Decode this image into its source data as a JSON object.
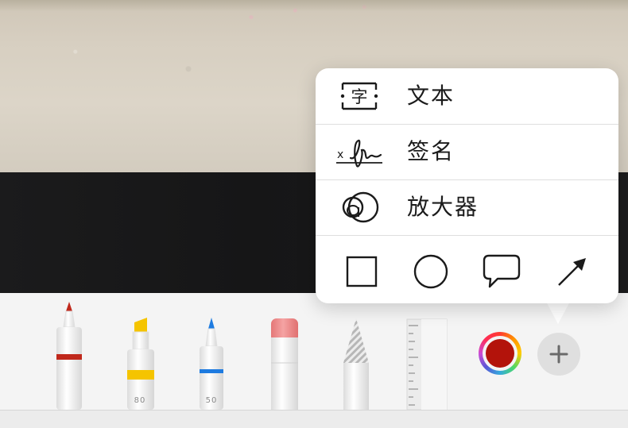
{
  "popover": {
    "items": [
      {
        "label": "文本",
        "icon": "text-box-icon",
        "glyph": "字"
      },
      {
        "label": "签名",
        "icon": "signature-icon",
        "glyph": "x"
      },
      {
        "label": "放大器",
        "icon": "magnifier-icon"
      }
    ],
    "shapes": [
      "square-icon",
      "circle-icon",
      "speech-bubble-icon",
      "arrow-icon"
    ]
  },
  "toolbar": {
    "tools": [
      {
        "name": "pen",
        "tip_color": "#c0281b",
        "band_color": "#c0281b"
      },
      {
        "name": "highlighter",
        "tip_color": "#f5c400",
        "band_color": "#f5c400",
        "label": "80"
      },
      {
        "name": "pencil",
        "tip_color": "#1e7be0",
        "band_color": "#1e7be0",
        "label": "50"
      },
      {
        "name": "eraser",
        "tip_color": "#f08a8a"
      },
      {
        "name": "lasso",
        "tip_color": "#bdbdbd"
      },
      {
        "name": "ruler"
      }
    ],
    "current_color": "#b3130b",
    "add_icon": "plus-icon"
  }
}
